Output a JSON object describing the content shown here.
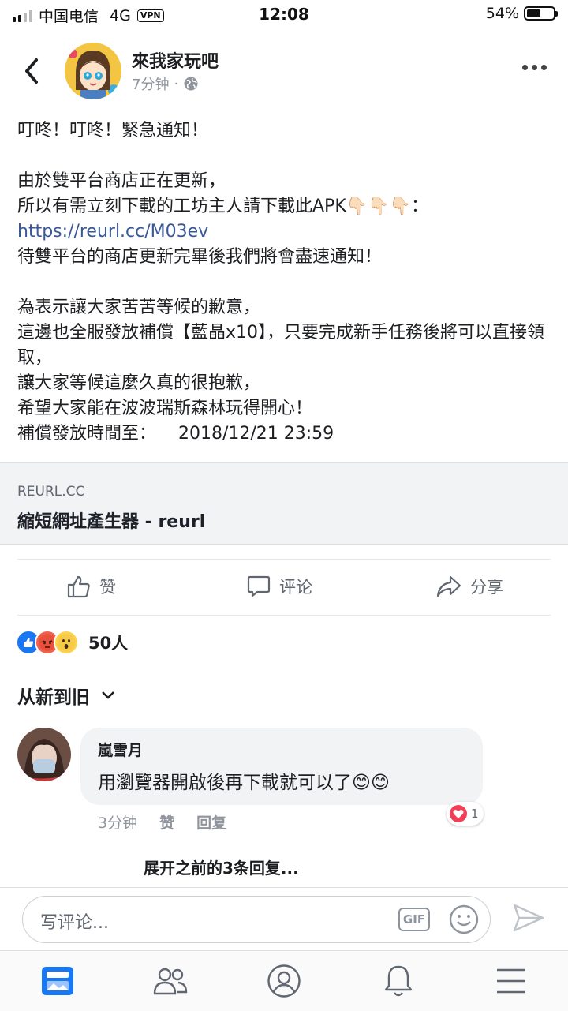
{
  "status_bar": {
    "carrier": "中国电信",
    "network": "4G",
    "vpn": "VPN",
    "time": "12:08",
    "battery": "54%",
    "battery_level": 0.54
  },
  "post": {
    "author": "來我家玩吧",
    "time": "7分钟",
    "separator": "·",
    "body": {
      "line1": "叮咚！叮咚！緊急通知！",
      "line2": "由於雙平台商店正在更新，",
      "line3_pre": "所以有需立刻下載的工坊主人請下載此APK",
      "line3_emoji": "👇🏻👇🏻👇🏻",
      "line3_post": "：",
      "link": "https://reurl.cc/M03ev",
      "line4": "待雙平台的商店更新完畢後我們將會盡速通知！",
      "line5": "為表示讓大家苦苦等候的歉意，",
      "line6": "這邊也全服發放補償【藍晶x10】，只要完成新手任務後將可以直接領取，",
      "line7": "讓大家等候這麼久真的很抱歉，",
      "line8": "希望大家能在波波瑞斯森林玩得開心！",
      "line9": "補償發放時間至：    2018/12/21 23:59"
    },
    "preview": {
      "domain": "REURL.CC",
      "title": "縮短網址產生器 - reurl"
    }
  },
  "actions": {
    "like": "赞",
    "comment": "评论",
    "share": "分享"
  },
  "reactions": {
    "count": "50人",
    "types": [
      "like-icon",
      "angry-icon",
      "wow-icon"
    ]
  },
  "comments_sort": "从新到旧",
  "comment": {
    "author": "嵐雪月",
    "text": "用瀏覽器開啟後再下載就可以了",
    "emoji": "😊😊",
    "time": "3分钟",
    "like": "赞",
    "reply": "回复",
    "reaction_count": "1"
  },
  "more_replies": "展开之前的3条回复...",
  "composer": {
    "placeholder": "写评论...",
    "gif": "GIF"
  },
  "tabs": [
    "news-feed-icon",
    "friends-icon",
    "profile-icon",
    "notifications-icon",
    "menu-icon"
  ],
  "colors": {
    "link": "#385898",
    "like_blue": "#1877f2",
    "active_tab": "#1877f2"
  }
}
